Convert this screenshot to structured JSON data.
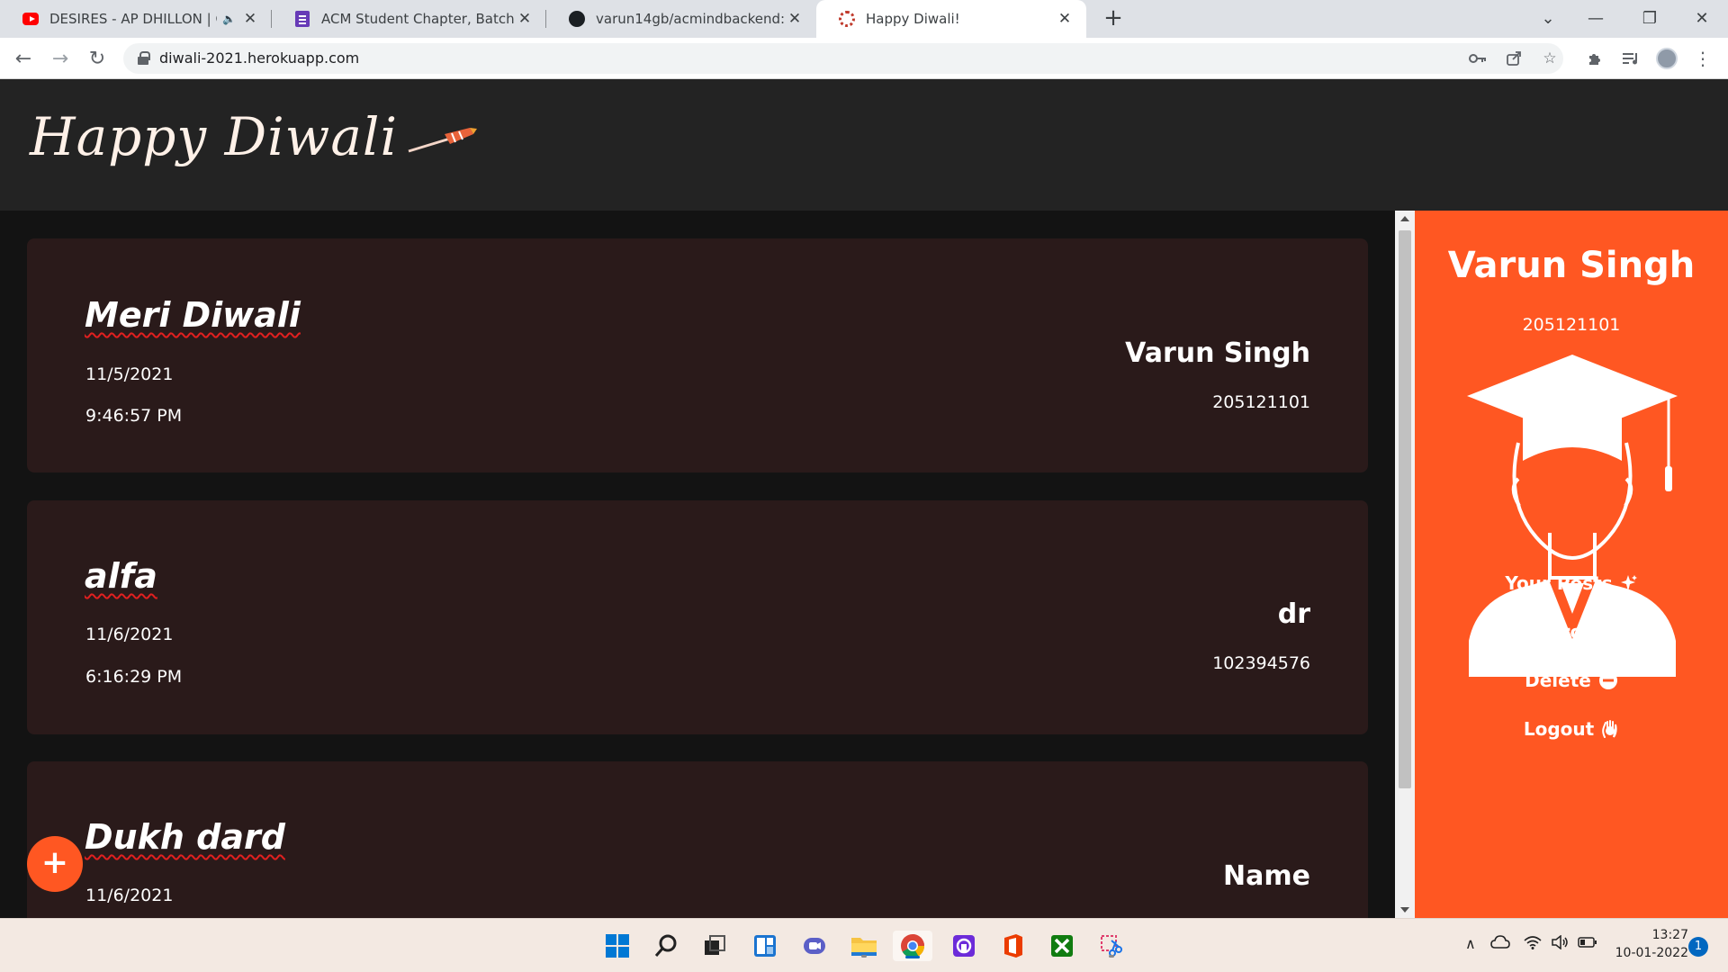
{
  "browser": {
    "tabs": [
      {
        "title": "DESIRES - AP DHILLON | GUR",
        "favicon": "youtube-icon",
        "audio": true
      },
      {
        "title": "ACM Student Chapter, Batch 202",
        "favicon": "google-forms-icon"
      },
      {
        "title": "varun14gb/acmindbackend: back",
        "favicon": "github-icon"
      },
      {
        "title": "Happy Diwali!",
        "favicon": "diwali-icon",
        "active": true
      }
    ],
    "url": "diwali-2021.herokuapp.com"
  },
  "site": {
    "logo_text": "Happy Diwali",
    "accent_color": "#ff5722",
    "card_color": "#2a1a1a"
  },
  "posts": [
    {
      "title": "Meri Diwali",
      "date": "11/5/2021",
      "time": "9:46:57 PM",
      "author": "Varun Singh",
      "roll": "205121101"
    },
    {
      "title": "alfa",
      "date": "11/6/2021",
      "time": "6:16:29 PM",
      "author": "dr",
      "roll": "102394576"
    },
    {
      "title": "Dukh dard",
      "date": "11/6/2021",
      "time": "",
      "author": "Name",
      "roll": ""
    }
  ],
  "sidebar": {
    "name": "Varun Singh",
    "roll": "205121101",
    "avatar_icon": "graduate-avatar-icon",
    "links": [
      {
        "label": "Your Posts",
        "icon": "sparkle-icon"
      },
      {
        "label": "Edit Profile",
        "icon": "writing-hand-icon"
      },
      {
        "label": "Delete",
        "icon": "minus-circle-icon"
      },
      {
        "label": "Logout",
        "icon": "hand-icon"
      }
    ]
  },
  "fab": {
    "label": "+"
  },
  "taskbar": {
    "time": "13:27",
    "date": "10-01-2022",
    "notifications": "1"
  }
}
